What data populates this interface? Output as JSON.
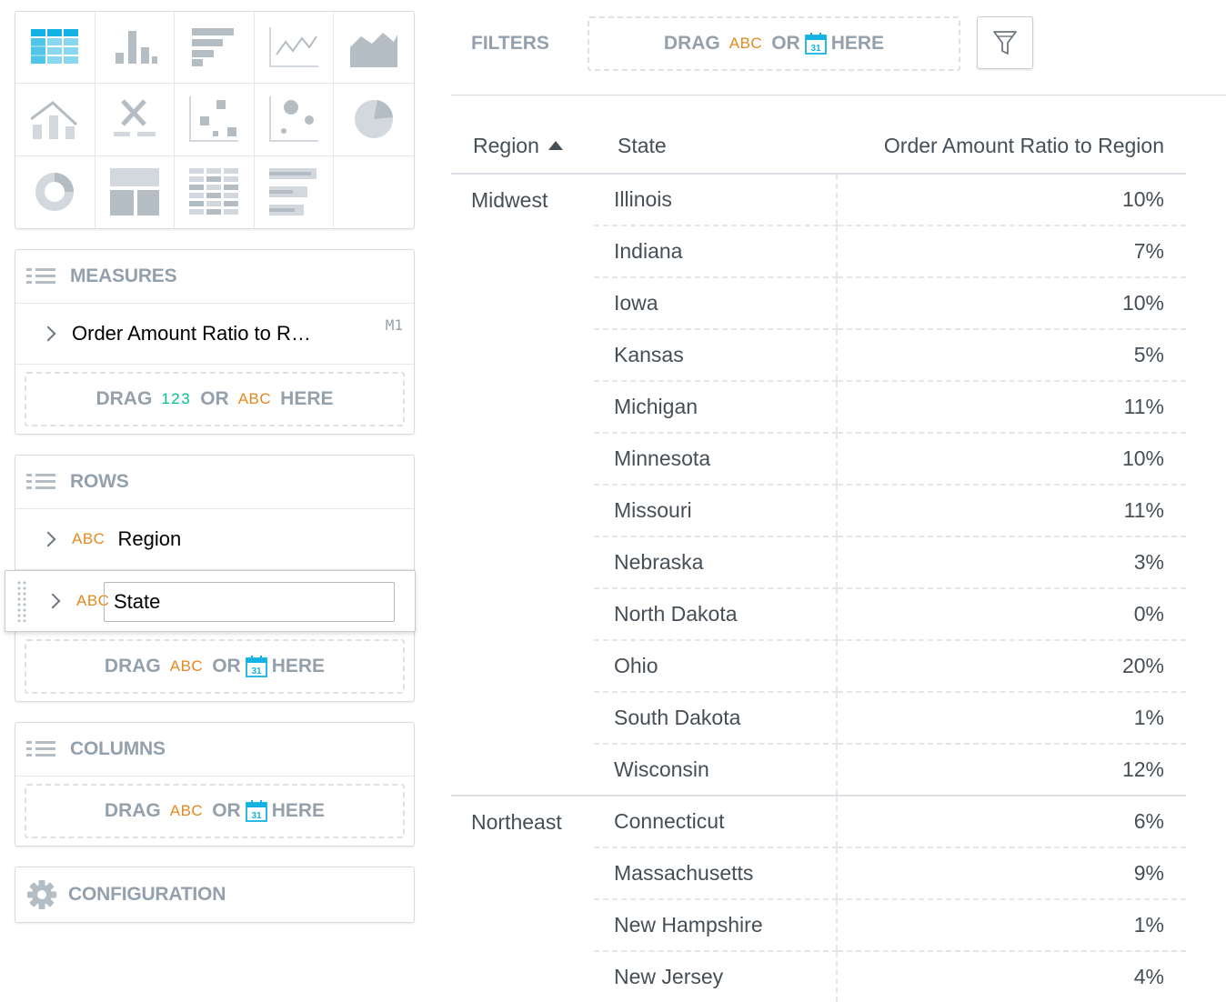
{
  "viz_types": [
    {
      "name": "table-viz-icon",
      "active": true
    },
    {
      "name": "column-chart-viz-icon"
    },
    {
      "name": "bar-chart-viz-icon"
    },
    {
      "name": "line-chart-viz-icon"
    },
    {
      "name": "area-chart-viz-icon"
    },
    {
      "name": "combo-chart-viz-icon"
    },
    {
      "name": "headline-viz-icon"
    },
    {
      "name": "scatter-plot-viz-icon"
    },
    {
      "name": "bubble-chart-viz-icon"
    },
    {
      "name": "pie-chart-viz-icon"
    },
    {
      "name": "donut-chart-viz-icon"
    },
    {
      "name": "treemap-viz-icon"
    },
    {
      "name": "heatmap-viz-icon"
    },
    {
      "name": "bullet-chart-viz-icon"
    }
  ],
  "measures": {
    "title": "MEASURES",
    "items": [
      {
        "label": "Order Amount Ratio to R…",
        "id": "M1"
      }
    ],
    "drop": {
      "drag": "DRAG",
      "num": "123",
      "or": "OR",
      "abc": "ABC",
      "here": "HERE"
    }
  },
  "rows": {
    "title": "ROWS",
    "items": [
      {
        "type": "ABC",
        "label": "Region"
      },
      {
        "type": "ABC",
        "label": "State"
      }
    ],
    "drop": {
      "drag": "DRAG",
      "abc": "ABC",
      "or": "OR",
      "cal": "31",
      "here": "HERE"
    }
  },
  "columns": {
    "title": "COLUMNS",
    "drop": {
      "drag": "DRAG",
      "abc": "ABC",
      "or": "OR",
      "cal": "31",
      "here": "HERE"
    }
  },
  "configuration": {
    "title": "CONFIGURATION"
  },
  "filters": {
    "label": "FILTERS",
    "drop": {
      "drag": "DRAG",
      "abc": "ABC",
      "or": "OR",
      "cal": "31",
      "here": "HERE"
    }
  },
  "table": {
    "headers": [
      "Region",
      "State",
      "Order Amount Ratio to Region"
    ],
    "sort": "ascending",
    "groups": [
      {
        "region": "Midwest",
        "rows": [
          {
            "state": "Illinois",
            "value": "10%"
          },
          {
            "state": "Indiana",
            "value": "7%"
          },
          {
            "state": "Iowa",
            "value": "10%"
          },
          {
            "state": "Kansas",
            "value": "5%"
          },
          {
            "state": "Michigan",
            "value": "11%"
          },
          {
            "state": "Minnesota",
            "value": "10%"
          },
          {
            "state": "Missouri",
            "value": "11%"
          },
          {
            "state": "Nebraska",
            "value": "3%"
          },
          {
            "state": "North Dakota",
            "value": "0%"
          },
          {
            "state": "Ohio",
            "value": "20%"
          },
          {
            "state": "South Dakota",
            "value": "1%"
          },
          {
            "state": "Wisconsin",
            "value": "12%"
          }
        ]
      },
      {
        "region": "Northeast",
        "rows": [
          {
            "state": "Connecticut",
            "value": "6%"
          },
          {
            "state": "Massachusetts",
            "value": "9%"
          },
          {
            "state": "New Hampshire",
            "value": "1%"
          },
          {
            "state": "New Jersey",
            "value": "4%"
          }
        ]
      }
    ]
  },
  "colors": {
    "accent": "#14b2e2",
    "abc": "#e5881f",
    "num": "#00c18d",
    "muted": "#94a1ad"
  }
}
